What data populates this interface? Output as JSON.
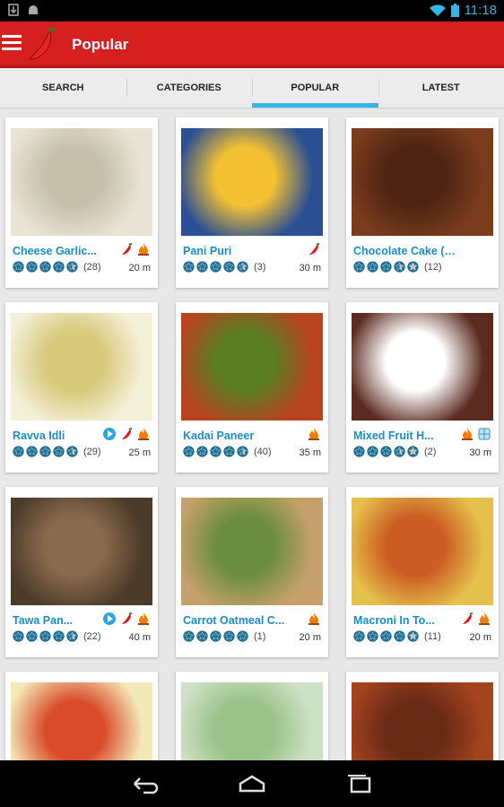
{
  "statusbar": {
    "time": "11:18"
  },
  "appbar": {
    "title": "Popular"
  },
  "tabs": [
    "SEARCH",
    "CATEGORIES",
    "POPULAR",
    "LATEST"
  ],
  "cards": [
    {
      "name": "Cheese Garlic...",
      "count": "(28)",
      "time": "20 m",
      "rating": 4.5
    },
    {
      "name": "Pani Puri",
      "count": "(3)",
      "time": "30 m",
      "rating": 4.5
    },
    {
      "name": "Chocolate Cake (egg...",
      "count": "(12)",
      "time": "",
      "rating": 3.5
    },
    {
      "name": "Ravva Idli",
      "count": "(29)",
      "time": "25 m",
      "rating": 4.5
    },
    {
      "name": "Kadai Paneer",
      "count": "(40)",
      "time": "35 m",
      "rating": 4.5
    },
    {
      "name": "Mixed Fruit H...",
      "count": "(2)",
      "time": "30 m",
      "rating": 3.5
    },
    {
      "name": "Tawa Pan...",
      "count": "(22)",
      "time": "40 m",
      "rating": 4.5
    },
    {
      "name": "Carrot Oatmeal C...",
      "count": "(1)",
      "time": "20 m",
      "rating": 5
    },
    {
      "name": "Macroni In To...",
      "count": "(11)",
      "time": "20 m",
      "rating": 4
    },
    {
      "name": "",
      "count": "",
      "time": "",
      "rating": 0
    },
    {
      "name": "",
      "count": "",
      "time": "",
      "rating": 0
    },
    {
      "name": "",
      "count": "",
      "time": "",
      "rating": 0
    }
  ]
}
